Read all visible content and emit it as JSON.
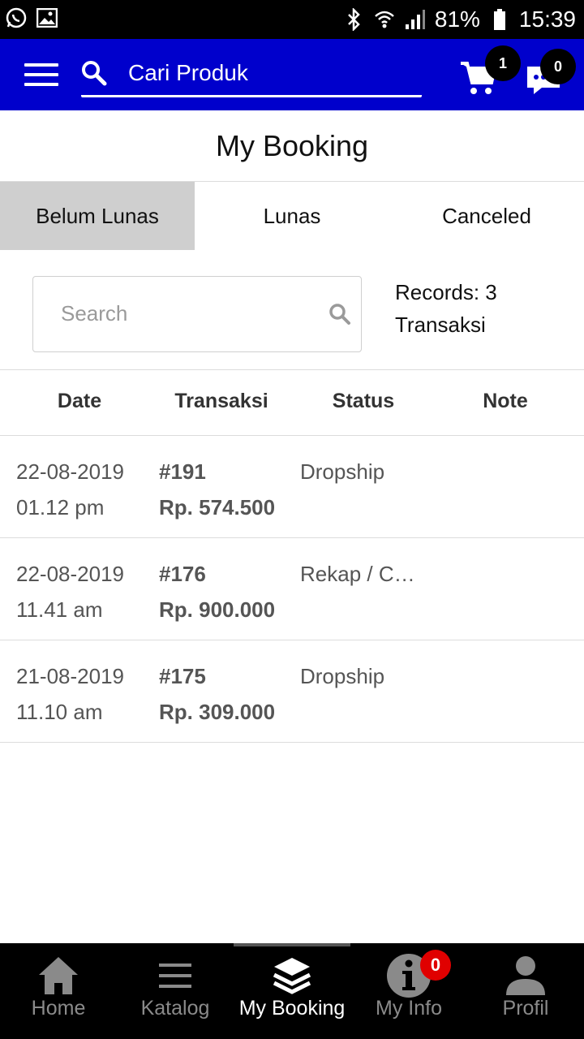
{
  "status_bar": {
    "battery": "81%",
    "time": "15:39",
    "left_icons": [
      "whatsapp-icon",
      "image-icon"
    ],
    "right_icons": [
      "bluetooth-icon",
      "wifi-icon",
      "signal-icon",
      "battery-icon"
    ]
  },
  "header": {
    "search_placeholder": "Cari Produk",
    "cart_count": "1",
    "chat_count": "0",
    "brand_color": "#0000cc"
  },
  "page": {
    "title": "My Booking"
  },
  "tabs": [
    {
      "label": "Belum Lunas",
      "active": true
    },
    {
      "label": "Lunas",
      "active": false
    },
    {
      "label": "Canceled",
      "active": false
    }
  ],
  "search": {
    "placeholder": "Search",
    "records_line1": "Records: 3",
    "records_line2": "Transaksi"
  },
  "table": {
    "headers": [
      "Date",
      "Transaksi",
      "Status",
      "Note"
    ],
    "rows": [
      {
        "date": "22-08-2019",
        "time": "01.12 pm",
        "id": "#191",
        "amount": "Rp. 574.500",
        "status": "Dropship",
        "note": ""
      },
      {
        "date": "22-08-2019",
        "time": "11.41 am",
        "id": "#176",
        "amount": "Rp. 900.000",
        "status": "Rekap / Customer",
        "note": ""
      },
      {
        "date": "21-08-2019",
        "time": "11.10 am",
        "id": "#175",
        "amount": "Rp. 309.000",
        "status": "Dropship",
        "note": ""
      }
    ]
  },
  "bottom_nav": {
    "items": [
      {
        "label": "Home",
        "icon": "home-icon",
        "active": false
      },
      {
        "label": "Katalog",
        "icon": "list-icon",
        "active": false
      },
      {
        "label": "My Booking",
        "icon": "layers-icon",
        "active": true
      },
      {
        "label": "My Info",
        "icon": "info-icon",
        "active": false
      },
      {
        "label": "Profil",
        "icon": "person-icon",
        "active": false
      }
    ],
    "info_badge": "0"
  }
}
